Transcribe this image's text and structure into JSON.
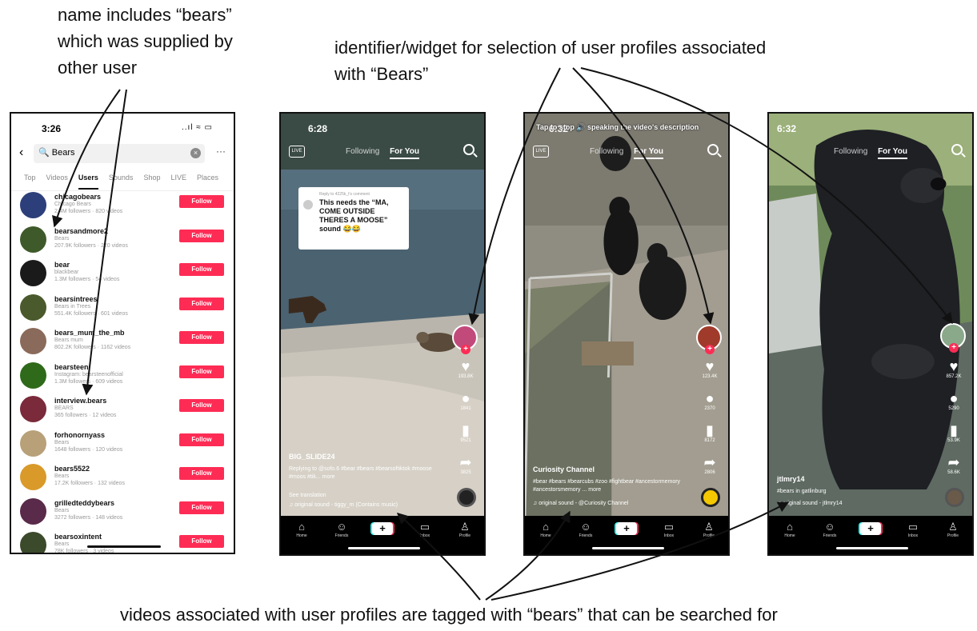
{
  "annotations": {
    "name_note": "name includes “bears” which was supplied by other user",
    "widget_note": "identifier/widget for selection of user profiles associated with “Bears”",
    "videos_note": "videos associated with user profiles are tagged with “bears” that can be searched for"
  },
  "search_screen": {
    "time": "3:26",
    "status_icons": "..ıl ≈ ▭",
    "query": "Bears",
    "tabs": [
      "Top",
      "Videos",
      "Users",
      "Sounds",
      "Shop",
      "LIVE",
      "Places"
    ],
    "active_tab": "Users",
    "follow_label": "Follow",
    "users": [
      {
        "name": "chicagobears",
        "sub": "Chicago Bears",
        "stats": "2.4M followers · 820 videos",
        "color": "#2d3f7a"
      },
      {
        "name": "bearsandmore2",
        "sub": "Bears",
        "stats": "207.9K followers · 220 videos",
        "color": "#3f5a2a"
      },
      {
        "name": "bear",
        "sub": "blackbear",
        "stats": "1.3M followers · 54 videos",
        "color": "#1a1a1a"
      },
      {
        "name": "bearsintrees",
        "sub": "Bears in Trees",
        "stats": "551.4K followers · 601 videos",
        "color": "#4a5a2c"
      },
      {
        "name": "bears_mum_the_mb",
        "sub": "Bears mum",
        "stats": "802.2K followers · 1162 videos",
        "color": "#8a6a5a"
      },
      {
        "name": "bearsteen",
        "sub": "Instagram: bearsteenofficial",
        "stats": "1.3M followers · 609 videos",
        "color": "#2e6a1a"
      },
      {
        "name": "interview.bears",
        "sub": "BEARS",
        "stats": "365 followers · 12 videos",
        "color": "#7a2a3a"
      },
      {
        "name": "forhonornyass",
        "sub": "Bears",
        "stats": "1648 followers · 120 videos",
        "color": "#b8a078"
      },
      {
        "name": "bears5522",
        "sub": "Bears",
        "stats": "17.2K followers · 132 videos",
        "color": "#d99a2a"
      },
      {
        "name": "grilledteddybears",
        "sub": "Bears",
        "stats": "3272 followers · 148 videos",
        "color": "#5a2a4a"
      },
      {
        "name": "bearsoxintent",
        "sub": "Bears",
        "stats": "78K followers · 3 videos",
        "color": "#3a4a2a"
      }
    ]
  },
  "video_nav": {
    "home": "Home",
    "friends": "Friends",
    "inbox": "Inbox",
    "profile": "Profile"
  },
  "video1": {
    "time": "6:28",
    "tab_following": "Following",
    "tab_foryou": "For You",
    "comment_reply": "Reply to 4225k_t's comment",
    "comment_text": "This needs the “MA, COME OUTSIDE THERES A MOOSE” sound 😂😂",
    "like_count": "193.8K",
    "comment_count": "1841",
    "save_count": "9521",
    "share_count": "3825",
    "author": "BIG_SLIDE24",
    "caption": "Replying to @sofo.6 #bear #bears #bearsoftiktok #moose #moos #tik... more",
    "translation": "See translation",
    "sound": "♫ original sound - tiggy_m (Contains music)"
  },
  "video2": {
    "time": "6:32",
    "overlay": "Tap to stop 🔊 speaking the video's description",
    "tab_following": "Following",
    "tab_foryou": "For You",
    "like_count": "123.4K",
    "comment_count": "2370",
    "save_count": "8172",
    "share_count": "2806",
    "author": "Curiosity Channel",
    "caption": "#bear #bears #bearcubs #zoo #fightbear #ancestormemory #ancestorsmemory ... more",
    "sound": "♫ original sound - @Curiosity Channel"
  },
  "video3": {
    "time": "6:32",
    "tab_following": "Following",
    "tab_foryou": "For You",
    "like_count": "857.2K",
    "comment_count": "5290",
    "save_count": "53.9K",
    "share_count": "58.6K",
    "author": "jtlmry14",
    "caption": "#bears in gatlinburg",
    "sound": "♫ original sound - jtlmry14"
  }
}
